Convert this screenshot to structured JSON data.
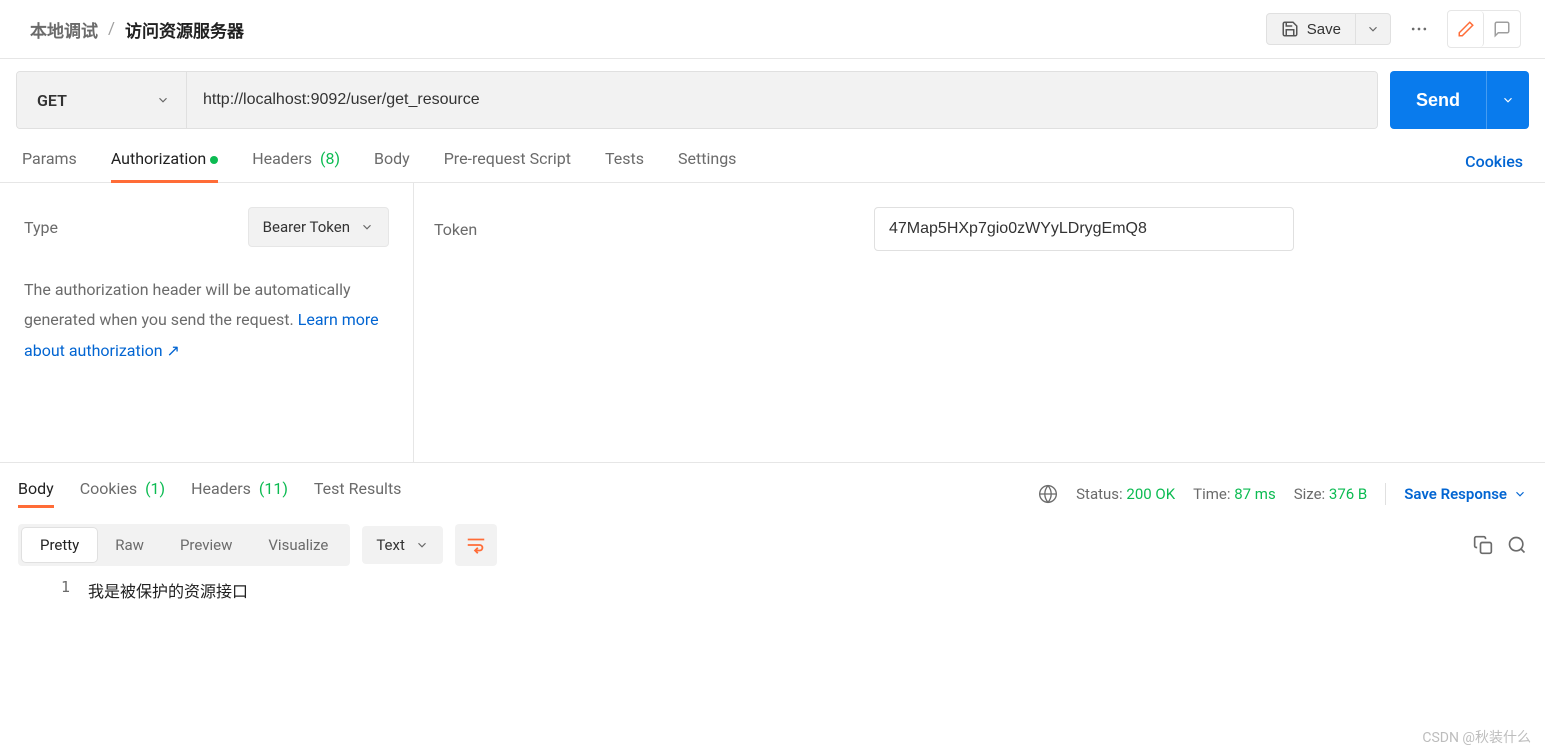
{
  "breadcrumb": {
    "parent": "本地调试",
    "sep": "/",
    "current": "访问资源服务器"
  },
  "top": {
    "save_label": "Save"
  },
  "request": {
    "method": "GET",
    "url": "http://localhost:9092/user/get_resource",
    "send_label": "Send",
    "tabs": {
      "params": "Params",
      "authorization": "Authorization",
      "headers": "Headers",
      "headers_count": "(8)",
      "body": "Body",
      "prerequest": "Pre-request Script",
      "tests": "Tests",
      "settings": "Settings"
    },
    "cookies_link": "Cookies"
  },
  "auth": {
    "type_label": "Type",
    "type_value": "Bearer Token",
    "help_text": "The authorization header will be automatically generated when you send the request. ",
    "help_link": "Learn more about authorization ↗",
    "token_label": "Token",
    "token_value": "47Map5HXp7gio0zWYyLDrygEmQ8"
  },
  "response": {
    "tabs": {
      "body": "Body",
      "cookies": "Cookies",
      "cookies_count": "(1)",
      "headers": "Headers",
      "headers_count": "(11)",
      "test_results": "Test Results"
    },
    "status_label": "Status:",
    "status_value": "200 OK",
    "time_label": "Time:",
    "time_value": "87 ms",
    "size_label": "Size:",
    "size_value": "376 B",
    "save_response": "Save Response",
    "view_tabs": {
      "pretty": "Pretty",
      "raw": "Raw",
      "preview": "Preview",
      "visualize": "Visualize"
    },
    "lang": "Text",
    "body_lines": {
      "1": "我是被保护的资源接口"
    }
  },
  "watermark": "CSDN @秋装什么"
}
